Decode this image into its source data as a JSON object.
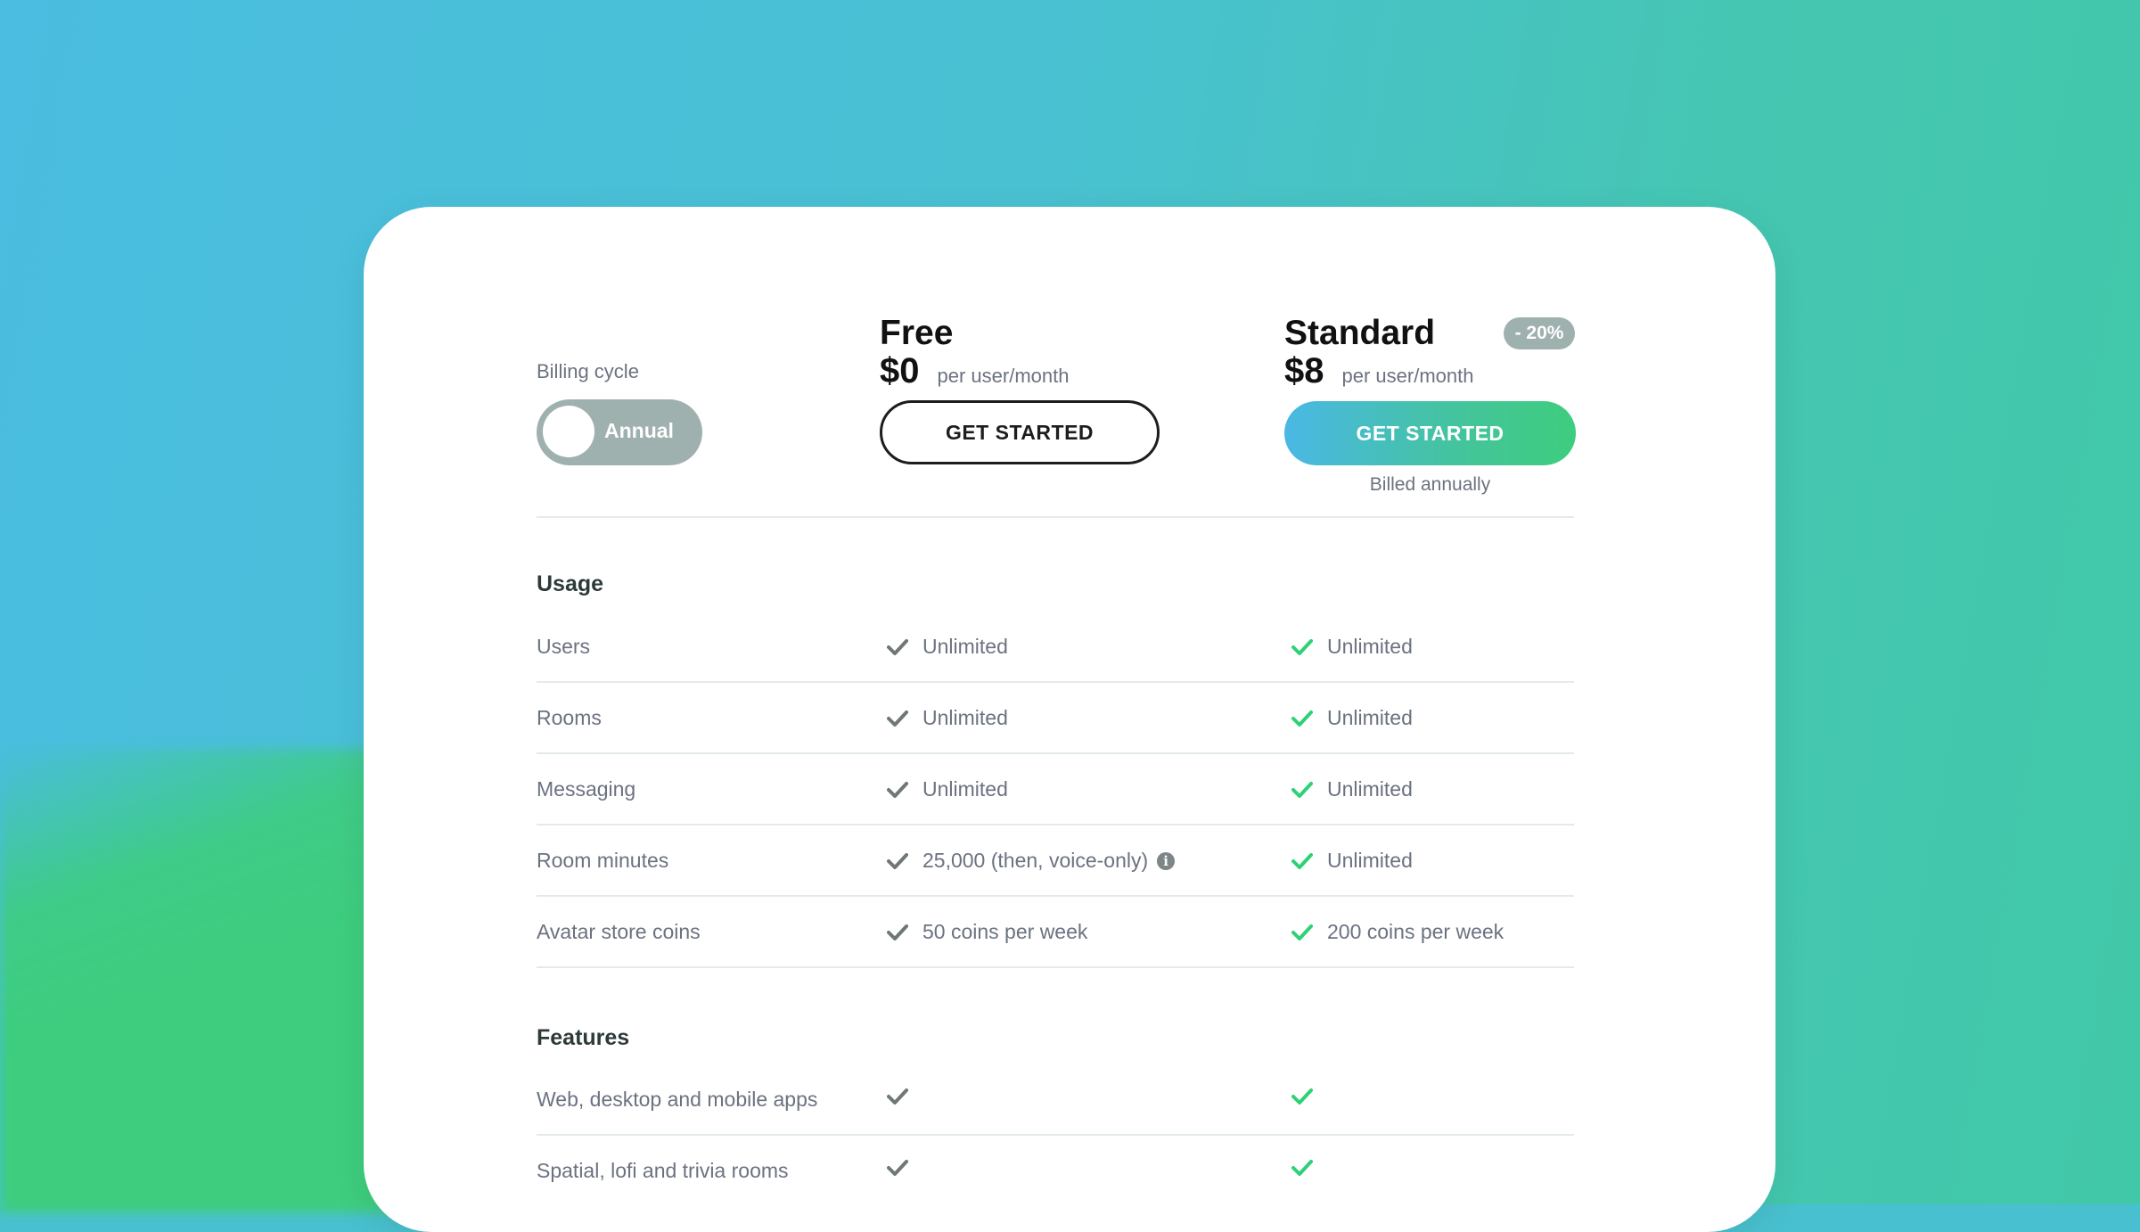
{
  "colors": {
    "accent_green": "#2fd176",
    "check_gray": "#6f7779",
    "toggle_bg": "#9fb1ae",
    "button_gradient_start": "#4ab8e5",
    "button_gradient_end": "#3ecd7e"
  },
  "billing": {
    "label": "Billing cycle",
    "toggle_value": "Annual"
  },
  "plans": [
    {
      "name": "Free",
      "price": "$0",
      "per": "per user/month",
      "cta": "GET STARTED"
    },
    {
      "name": "Standard",
      "price": "$8",
      "per": "per user/month",
      "cta": "GET STARTED",
      "badge": "- 20%",
      "note": "Billed annually"
    }
  ],
  "sections": {
    "usage": {
      "title": "Usage",
      "rows": [
        {
          "label": "Users",
          "free": "Unlimited",
          "standard": "Unlimited"
        },
        {
          "label": "Rooms",
          "free": "Unlimited",
          "standard": "Unlimited"
        },
        {
          "label": "Messaging",
          "free": "Unlimited",
          "standard": "Unlimited"
        },
        {
          "label": "Room minutes",
          "free": "25,000 (then, voice-only)",
          "standard": "Unlimited"
        },
        {
          "label": "Avatar store coins",
          "free": "50 coins per week",
          "standard": "200 coins per week"
        }
      ]
    },
    "features": {
      "title": "Features",
      "rows": [
        {
          "label": "Web, desktop and mobile apps",
          "free": "",
          "standard": ""
        },
        {
          "label": "Spatial, lofi and trivia rooms",
          "free": "",
          "standard": ""
        }
      ]
    }
  },
  "icons": {
    "free_check": "check-gray-icon",
    "standard_check": "check-green-icon",
    "room_minutes_info": "info-icon",
    "toggle_knob": "toggle-knob"
  }
}
